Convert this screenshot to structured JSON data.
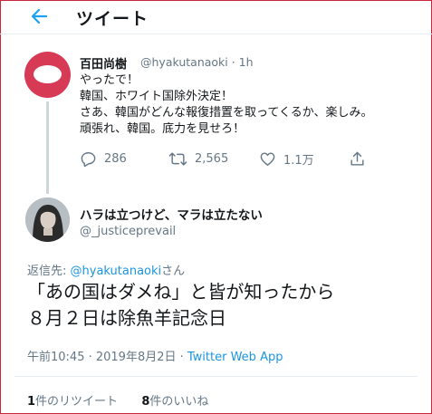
{
  "header": {
    "title": "ツイート"
  },
  "tweet1": {
    "name": "百田尚樹",
    "handle": "@hyakutanaoki · 1h",
    "lines": [
      "やったで！",
      "韓国、ホワイト国除外決定！",
      "さあ、韓国がどんな報復措置を取ってくるか、楽しみ。",
      "頑張れ、韓国。底力を見せろ！"
    ],
    "replies": "286",
    "retweets": "2,565",
    "likes": "1.1万",
    "avatar_color": "#d63a55"
  },
  "tweet2": {
    "name": "ハラは立つけど、マラは立たない",
    "handle": "@_justiceprevail",
    "reply_prefix": "返信先: ",
    "reply_mention": "@hyakutanaoki",
    "reply_suffix": "さん",
    "lines": [
      "「あの国はダメね」と皆が知ったから",
      "８月２日は除魚羊記念日"
    ],
    "timestamp": "午前10:45 · 2019年8月2日 · ",
    "app": "Twitter Web App",
    "retweet_count": "1",
    "retweet_label": "件のリツイート",
    "like_count": "8",
    "like_label": "件のいいね"
  },
  "colors": {
    "accent": "#1b95e0",
    "secondary_text": "#657786",
    "frame": "#c8283c"
  }
}
